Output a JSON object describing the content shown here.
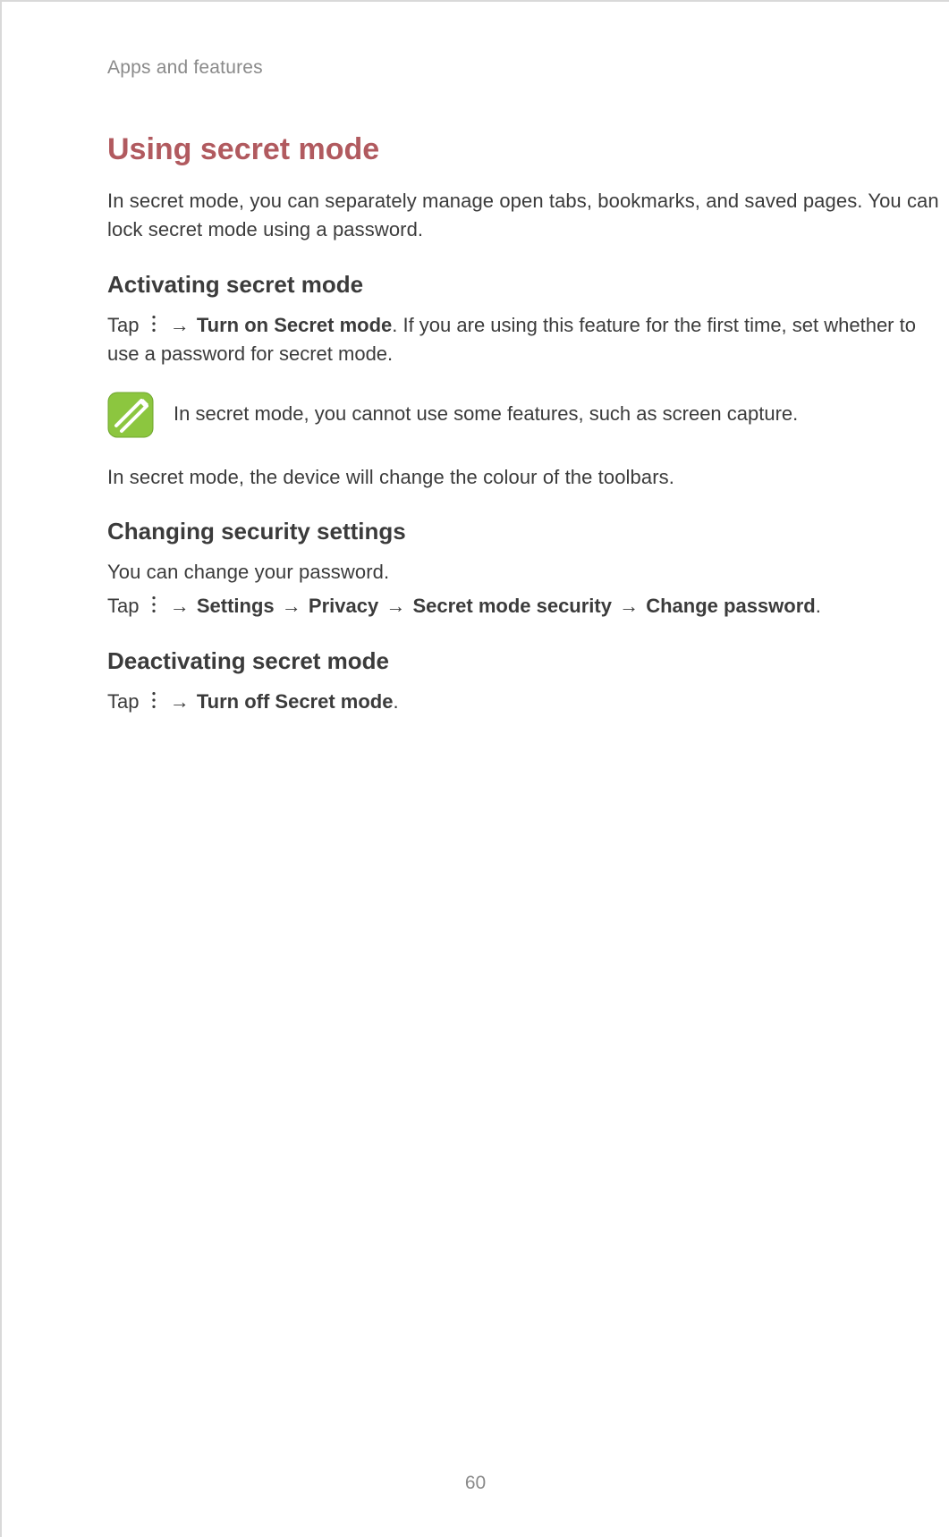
{
  "header": {
    "section_label": "Apps and features"
  },
  "title": "Using secret mode",
  "intro": "In secret mode, you can separately manage open tabs, bookmarks, and saved pages. You can lock secret mode using a password.",
  "arrow": "→",
  "s1": {
    "heading": "Activating secret mode",
    "p_a": "Tap ",
    "p_b": " ",
    "b1": "Turn on Secret mode",
    "p_c": ". If you are using this feature for the first time, set whether to use a password for secret mode.",
    "note": "In secret mode, you cannot use some features, such as screen capture.",
    "after": "In secret mode, the device will change the colour of the toolbars."
  },
  "s2": {
    "heading": "Changing security settings",
    "lead": "You can change your password.",
    "tap": "Tap ",
    "space": " ",
    "b_settings": "Settings",
    "b_privacy": "Privacy",
    "b_sms": "Secret mode security",
    "b_change": "Change password",
    "period": "."
  },
  "s3": {
    "heading": "Deactivating secret mode",
    "tap": "Tap ",
    "space": " ",
    "b_off": "Turn off Secret mode",
    "period": "."
  },
  "page_number": "60"
}
